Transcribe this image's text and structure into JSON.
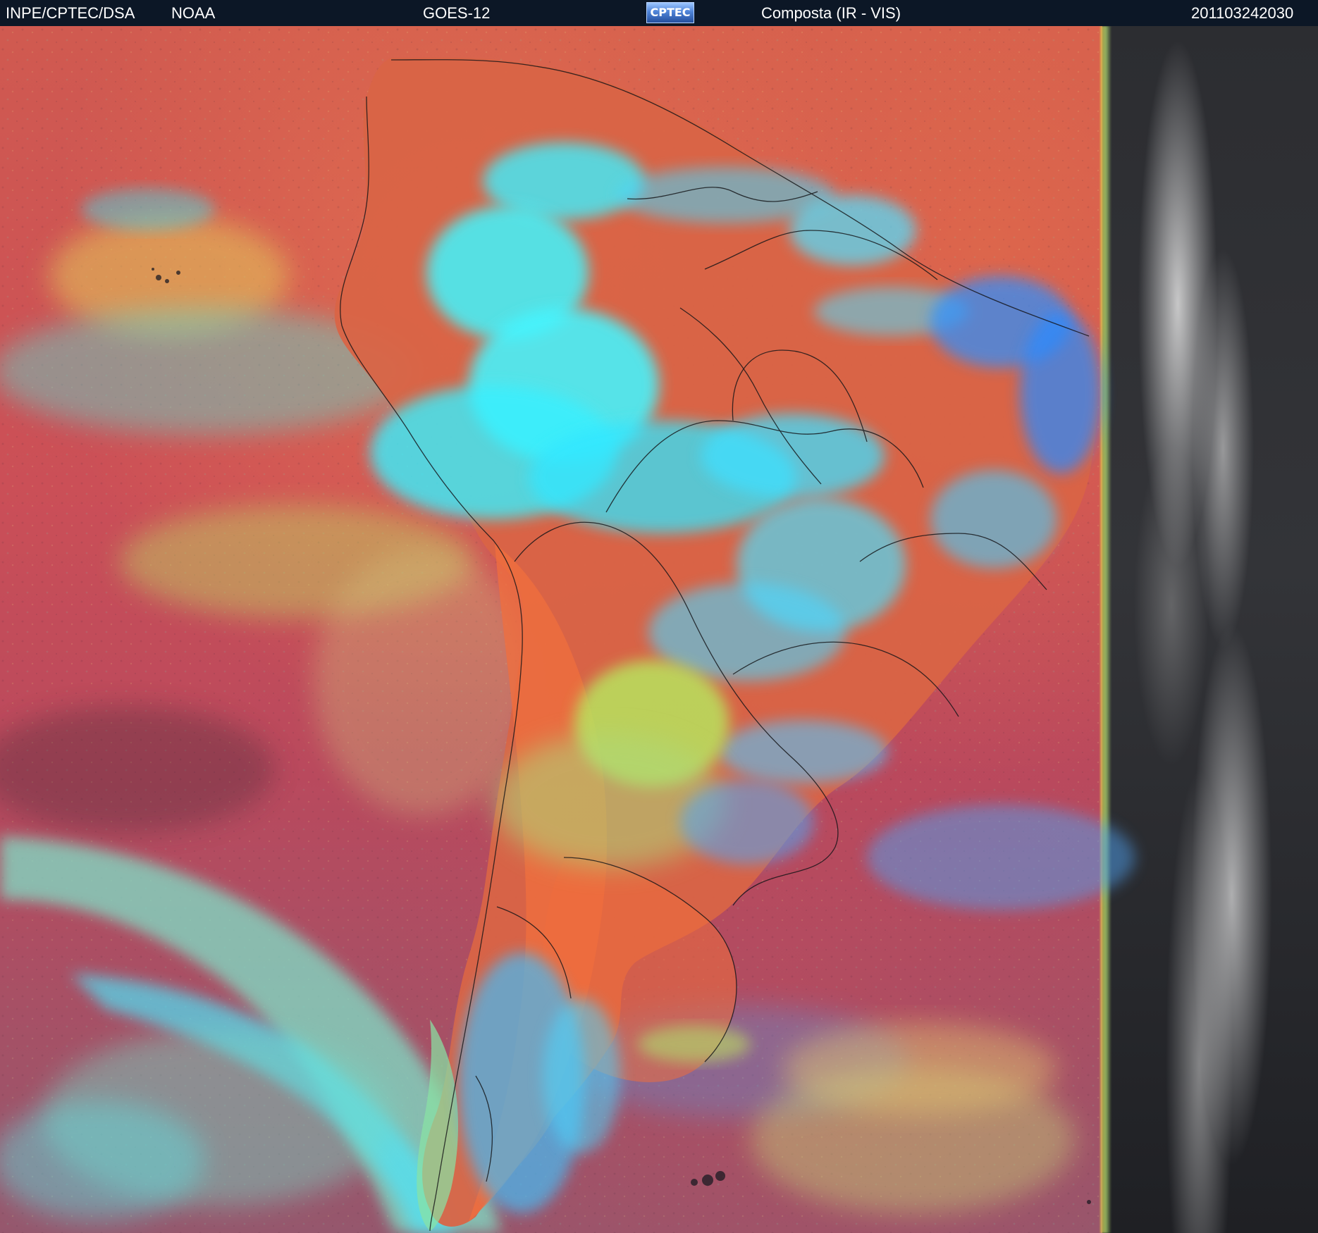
{
  "header": {
    "source": "INPE/CPTEC/DSA",
    "provider": "NOAA",
    "satellite": "GOES-12",
    "logo": "CPTEC",
    "product": "Composta (IR - VIS)",
    "timestamp": "201103242030"
  }
}
